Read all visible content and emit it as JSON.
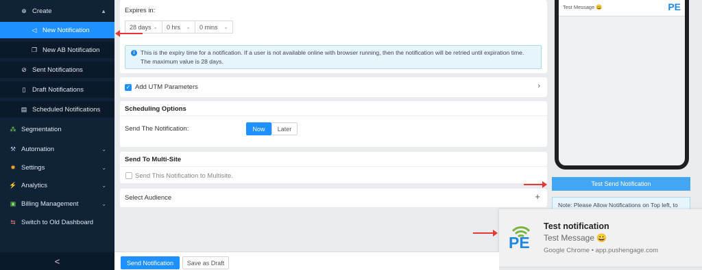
{
  "sidebar": {
    "create": {
      "label": "Create",
      "icon": "plus-circle-icon"
    },
    "new_notification": {
      "label": "New Notification",
      "icon": "megaphone-icon"
    },
    "new_ab": {
      "label": "New AB Notification",
      "icon": "copy-icon"
    },
    "sent": {
      "label": "Sent Notifications",
      "icon": "check-circle-icon"
    },
    "draft": {
      "label": "Draft Notifications",
      "icon": "file-icon"
    },
    "scheduled": {
      "label": "Scheduled Notifications",
      "icon": "calendar-icon"
    },
    "segmentation": {
      "label": "Segmentation",
      "icon": "segment-icon"
    },
    "automation": {
      "label": "Automation",
      "icon": "automation-icon"
    },
    "settings": {
      "label": "Settings",
      "icon": "gear-icon"
    },
    "analytics": {
      "label": "Analytics",
      "icon": "analytics-icon"
    },
    "billing": {
      "label": "Billing Management",
      "icon": "billing-icon"
    },
    "switch": {
      "label": "Switch to Old Dashboard",
      "icon": "switch-icon"
    },
    "collapse_glyph": "<"
  },
  "expiry": {
    "label": "Expires in:",
    "days": "28 days",
    "hrs": "0 hrs",
    "mins": "0 mins",
    "info": "This is the expiry time for a notification. If a user is not available online with browser running, then the notification will be retried until expiration time. The maximum value is 28 days."
  },
  "utm": {
    "label": "Add UTM Parameters",
    "checked": true
  },
  "scheduling": {
    "title": "Scheduling Options",
    "send_label": "Send The Notification:",
    "now": "Now",
    "later": "Later"
  },
  "multisite": {
    "title": "Send To Multi-Site",
    "checkbox_label": "Send This Notification to Multisite."
  },
  "audience": {
    "label": "Select Audience"
  },
  "footer": {
    "send": "Send Notification",
    "draft": "Save as Draft"
  },
  "preview": {
    "message": "Test Message 😀",
    "test_send": "Test Send Notification",
    "note": "Note: Please Allow Notifications on Top left, to"
  },
  "toast": {
    "title": "Test notification",
    "message": "Test Message 😀",
    "source": "Google Chrome • app.pushengage.com",
    "logo_text": "PE"
  },
  "colors": {
    "accent": "#1e90ff",
    "sidebar": "#0f2236",
    "arrow": "#e53935"
  }
}
